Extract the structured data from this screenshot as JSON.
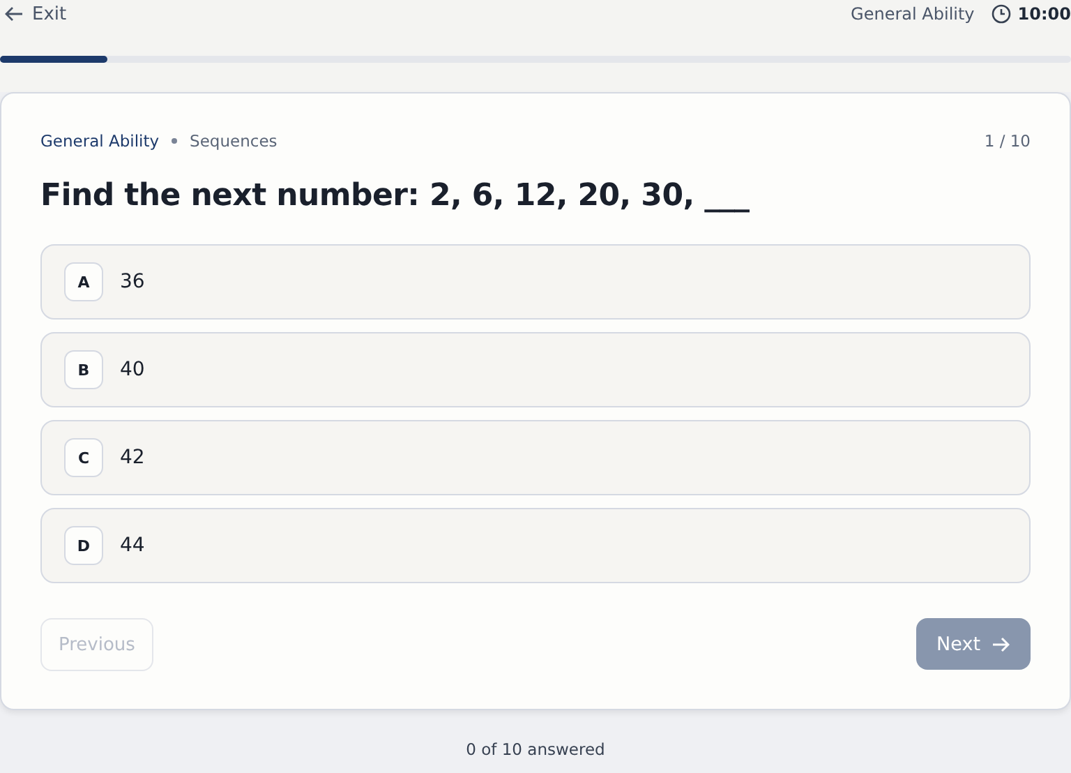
{
  "header": {
    "exit": "Exit",
    "section": "General Ability",
    "timer": "10:00"
  },
  "progress": {
    "level": 0.1
  },
  "card": {
    "category": "General Ability",
    "subcategory": "Sequences",
    "counter": "1 / 10",
    "question": "Find the next number: 2, 6, 12, 20, 30, ___",
    "options": [
      {
        "letter": "A",
        "text": "36",
        "selected": false
      },
      {
        "letter": "B",
        "text": "40",
        "selected": false
      },
      {
        "letter": "C",
        "text": "42",
        "selected": false
      },
      {
        "letter": "D",
        "text": "44",
        "selected": false
      }
    ],
    "previous": {
      "label": "Previous",
      "disabled": true
    },
    "next": {
      "label": "Next",
      "disabled": true
    }
  },
  "status": "0 of 10 answered"
}
